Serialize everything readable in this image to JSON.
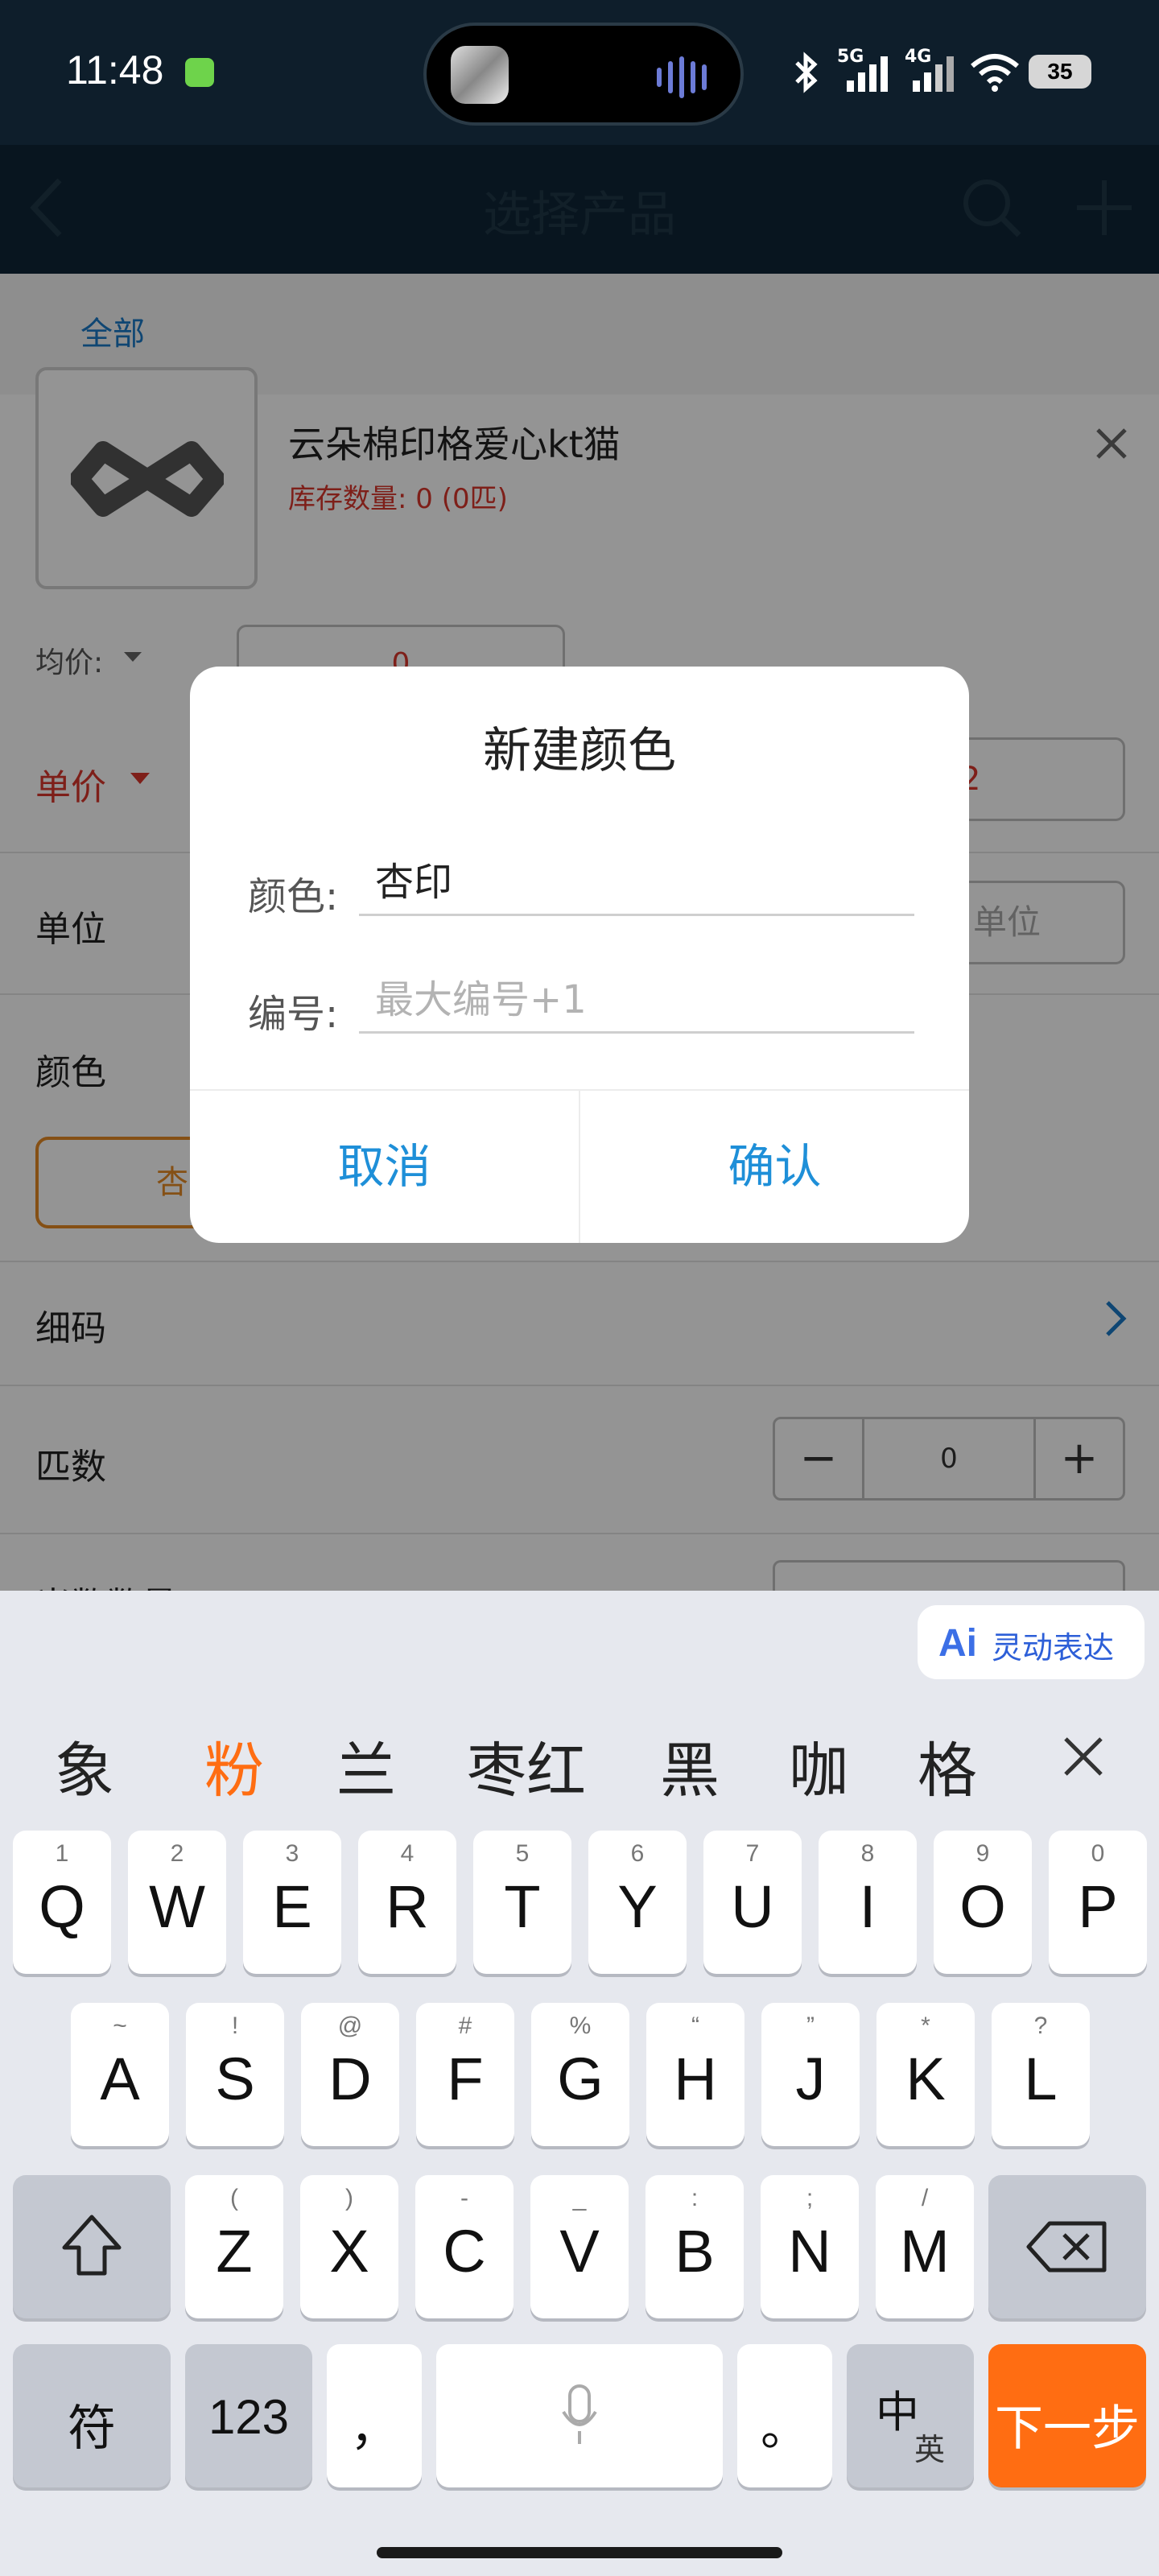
{
  "status_bar": {
    "time": "11:48",
    "net_1": "5G",
    "net_2": "4G",
    "battery": "35"
  },
  "header": {
    "title": "选择产品"
  },
  "tabs": {
    "all": "全部"
  },
  "product": {
    "name": "云朵棉印格爱心kt猫",
    "stock": "库存数量: 0 (0匹)"
  },
  "form": {
    "avg_price_label": "均价:",
    "avg_price_value": "0",
    "unit_price_label": "单价",
    "unit_price_value_partial": "2",
    "unit_label": "单位",
    "unit_placeholder": "单位",
    "color_label": "颜色",
    "color_chip_partial": "杏",
    "size_label": "细码",
    "bolts_label": "匹数",
    "bolts_value": "0",
    "bottom_label_partial": "米数数量"
  },
  "dialog": {
    "title": "新建颜色",
    "color_label": "颜色:",
    "color_value": "杏印",
    "code_label": "编号:",
    "code_placeholder": "最大编号+1",
    "cancel": "取消",
    "confirm": "确认"
  },
  "keyboard": {
    "ai_label": "灵动表达",
    "candidates": [
      "象",
      "粉",
      "兰",
      "枣红",
      "黑",
      "咖",
      "格"
    ],
    "highlight_color": "#ff6d12",
    "row1": [
      [
        "Q",
        "1"
      ],
      [
        "W",
        "2"
      ],
      [
        "E",
        "3"
      ],
      [
        "R",
        "4"
      ],
      [
        "T",
        "5"
      ],
      [
        "Y",
        "6"
      ],
      [
        "U",
        "7"
      ],
      [
        "I",
        "8"
      ],
      [
        "O",
        "9"
      ],
      [
        "P",
        "0"
      ]
    ],
    "row2": [
      [
        "A",
        "~"
      ],
      [
        "S",
        "!"
      ],
      [
        "D",
        "@"
      ],
      [
        "F",
        "#"
      ],
      [
        "G",
        "%"
      ],
      [
        "H",
        "“"
      ],
      [
        "J",
        "”"
      ],
      [
        "K",
        "*"
      ],
      [
        "L",
        "?"
      ]
    ],
    "row3": [
      [
        "Z",
        "("
      ],
      [
        "X",
        ")"
      ],
      [
        "C",
        "-"
      ],
      [
        "V",
        "_"
      ],
      [
        "B",
        ":"
      ],
      [
        "N",
        ";"
      ],
      [
        "M",
        "/"
      ]
    ],
    "symbols": "符",
    "numbers": "123",
    "comma": "，",
    "period": "。",
    "lang_main": "中",
    "lang_sub": "英",
    "enter": "下一步"
  }
}
